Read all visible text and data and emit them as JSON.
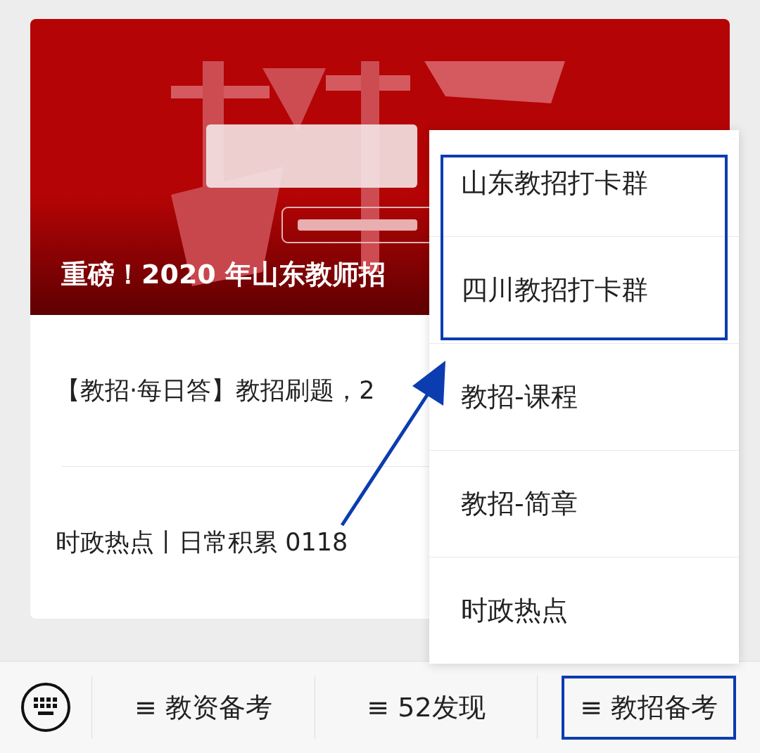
{
  "article_card": {
    "cover": {
      "title": "重磅！2020 年山东教师招"
    },
    "rows": [
      {
        "title": "【教招·每日答】教招刷题，2"
      },
      {
        "title": "时政热点丨日常积累 0118"
      }
    ]
  },
  "menu": {
    "items": [
      {
        "label": "山东教招打卡群",
        "highlighted": true
      },
      {
        "label": "四川教招打卡群",
        "highlighted": true
      },
      {
        "label": "教招-课程",
        "highlighted": false
      },
      {
        "label": "教招-简章",
        "highlighted": false
      },
      {
        "label": "时政热点",
        "highlighted": false
      }
    ]
  },
  "bottom_bar": {
    "buttons": [
      {
        "label": "≡ 教资备考",
        "highlighted": false
      },
      {
        "label": "≡ 52发现",
        "highlighted": false
      },
      {
        "label": "≡ 教招备考",
        "highlighted": true
      }
    ]
  }
}
